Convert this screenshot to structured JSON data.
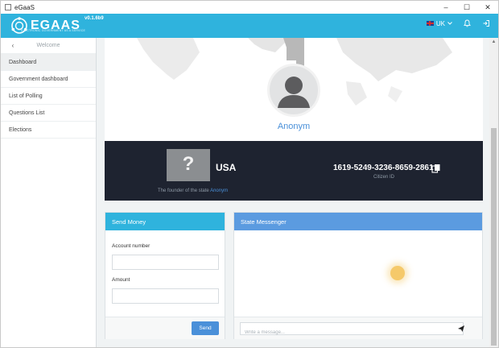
{
  "window": {
    "title": "eGaaS",
    "controls": [
      "–",
      "☐",
      "✕"
    ]
  },
  "header": {
    "logo_text": "EGAAS",
    "logo_subtitle": "ELECTRONIC GOVERNMENT AS A SERVICE",
    "version": "v0.1.6b9",
    "language": "UK",
    "icons": [
      "flag-uk-icon",
      "chevron-down-icon",
      "bell-icon",
      "logout-icon"
    ]
  },
  "sidebar": {
    "back_label": "Welcome",
    "items": [
      {
        "label": "Dashboard",
        "active": true
      },
      {
        "label": "Government dashboard",
        "active": false
      },
      {
        "label": "List of Polling",
        "active": false
      },
      {
        "label": "Questions List",
        "active": false
      },
      {
        "label": "Elections",
        "active": false
      }
    ]
  },
  "profile": {
    "name": "Anonym"
  },
  "state": {
    "country": "USA",
    "founder_label": "The founder of the state",
    "founder_name": "Anonym",
    "citizen_id": "1619-5249-3236-8659-2861",
    "citizen_id_label": "Citizen ID"
  },
  "send_money": {
    "title": "Send Money",
    "account_label": "Account number",
    "account_value": "",
    "amount_label": "Amount",
    "amount_value": "",
    "button": "Send"
  },
  "messenger": {
    "title": "State Messenger",
    "placeholder": "Write a message..."
  },
  "colors": {
    "header": "#2fb3dd",
    "dark_panel": "#1e2330",
    "link": "#4a90d9",
    "send_panel_head": "#2fb3dd",
    "messenger_head": "#5b9be0"
  }
}
